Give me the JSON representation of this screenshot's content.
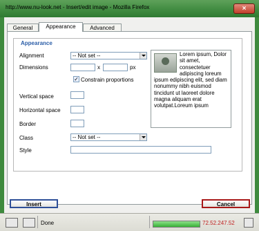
{
  "window": {
    "title": "http://www.nu-look.net - Insert/edit image - Mozilla Firefox",
    "close_glyph": "×"
  },
  "tabs": [
    {
      "label": "General"
    },
    {
      "label": "Appearance"
    },
    {
      "label": "Advanced"
    }
  ],
  "appearance": {
    "legend": "Appearance",
    "alignment_label": "Alignment",
    "alignment_value": "-- Not set --",
    "dimensions_label": "Dimensions",
    "dimensions_sep": "x",
    "dimensions_unit": "px",
    "width_value": "",
    "height_value": "",
    "constrain_label": "Constrain proportions",
    "constrain_checked": "✓",
    "vspace_label": "Vertical space",
    "hspace_label": "Horizontal space",
    "border_label": "Border",
    "class_label": "Class",
    "class_value": "-- Not set --",
    "style_label": "Style",
    "style_value": "",
    "preview_text": "Lorem ipsum, Dolor sit amet, consectetuer adipiscing loreum ipsum edipiscing elit, sed diam nonummy nibh euismod tincidunt ut laoreet dolore magna aliquam erat volutpat.Loreum ipsum"
  },
  "buttons": {
    "insert": "Insert",
    "cancel": "Cancel"
  },
  "statusbar": {
    "status": "Done",
    "ip": "72.52.247.52",
    "progress": 1.0
  }
}
